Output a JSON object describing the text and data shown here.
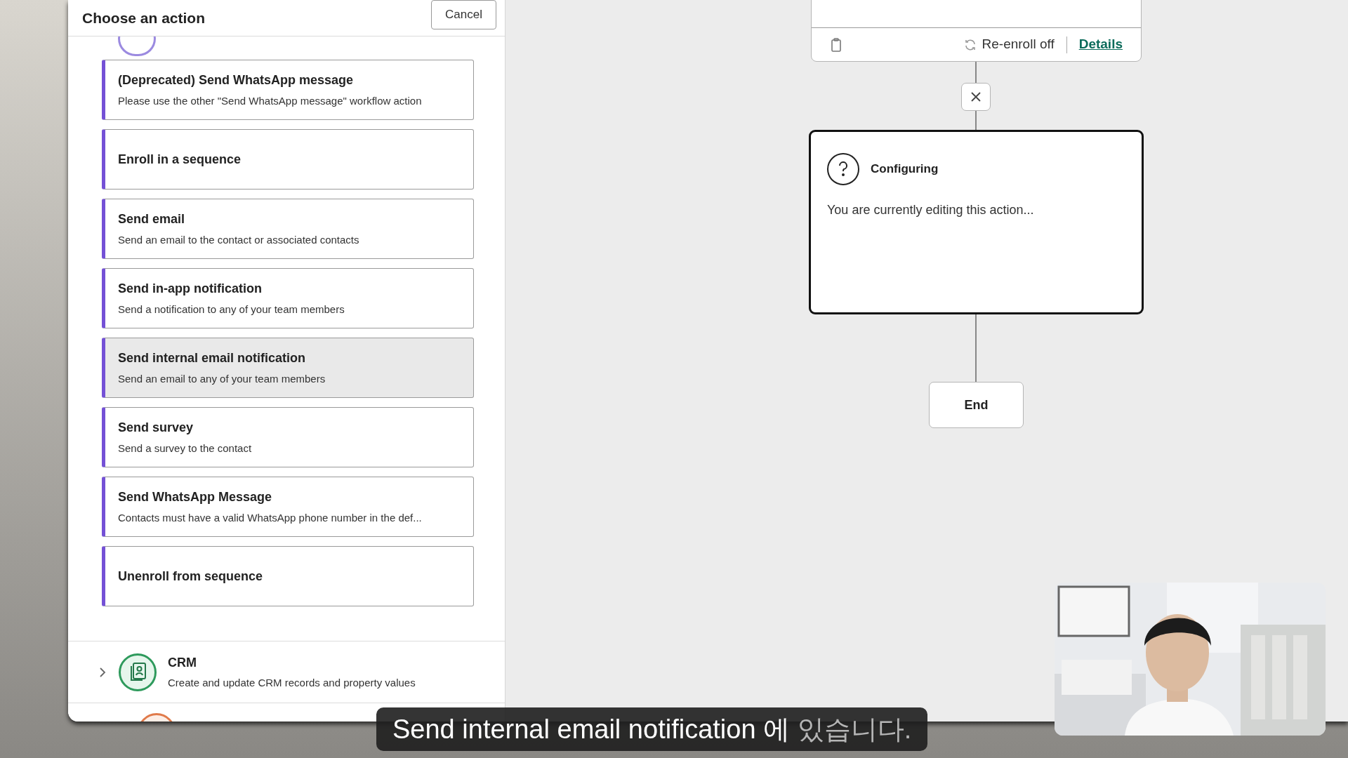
{
  "panel": {
    "title": "Choose an action",
    "cancel_label": "Cancel",
    "actions": [
      {
        "title": "(Deprecated) Send WhatsApp message",
        "description": "Please use the other \"Send WhatsApp message\" workflow action",
        "highlighted": false
      },
      {
        "title": "Enroll in a sequence",
        "highlighted": false
      },
      {
        "title": "Send email",
        "description": "Send an email to the contact or associated contacts",
        "highlighted": false
      },
      {
        "title": "Send in-app notification",
        "description": "Send a notification to any of your team members",
        "highlighted": false
      },
      {
        "title": "Send internal email notification",
        "description": "Send an email to any of your team members",
        "highlighted": true
      },
      {
        "title": "Send survey",
        "description": "Send a survey to the contact",
        "highlighted": false
      },
      {
        "title": "Send WhatsApp Message",
        "description": "Contacts must have a valid WhatsApp phone number in the def...",
        "highlighted": false
      },
      {
        "title": "Unenroll from sequence",
        "highlighted": false
      }
    ],
    "categories": [
      {
        "title": "CRM",
        "description": "Create and update CRM records and property values",
        "expanded": false
      }
    ]
  },
  "canvas": {
    "node_footer": {
      "reenroll": "Re-enroll off",
      "details_link": "Details"
    },
    "configuring_card": {
      "title": "Configuring",
      "message": "You are currently editing this action..."
    },
    "end_node": "End"
  },
  "subtitle": {
    "spoken": "Send internal email notification 에",
    "upcoming": "있습니다."
  }
}
